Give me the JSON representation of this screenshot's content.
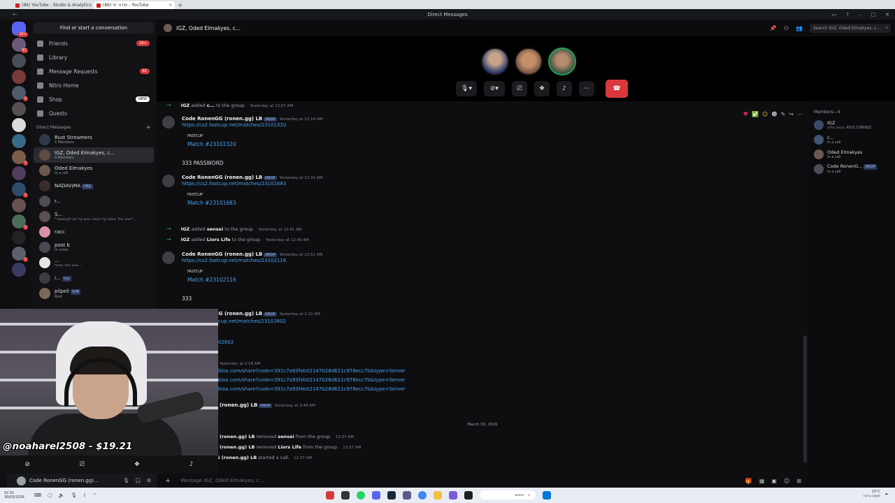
{
  "browser": {
    "tabs": [
      {
        "label": "(86) YouTube - Studio & Analytics",
        "active": false
      },
      {
        "label": "(86) שידור חי - YouTube",
        "active": true
      }
    ]
  },
  "window": {
    "title": "Direct Messages"
  },
  "rail": {
    "badges": [
      "1K+",
      "67",
      "2",
      "1",
      "1",
      "2",
      "1"
    ]
  },
  "sidebar": {
    "find_placeholder": "Find or start a conversation",
    "nav": [
      {
        "label": "Friends",
        "badge": "1K+",
        "icon": "friends-icon"
      },
      {
        "label": "Library",
        "badge": "",
        "icon": "library-icon"
      },
      {
        "label": "Message Requests",
        "badge": "82",
        "icon": "message-requests-icon"
      },
      {
        "label": "Nitro Home",
        "badge": "",
        "icon": "nitro-icon"
      },
      {
        "label": "Shop",
        "badge": "NEW",
        "icon": "shop-icon"
      },
      {
        "label": "Quests",
        "badge": "",
        "icon": "quests-icon"
      }
    ],
    "dm_header": "Direct Messages",
    "dms": [
      {
        "name": "Rust Streamers",
        "sub": "5 Members",
        "selected": false
      },
      {
        "name": "IGZ, Oded Elmakyes, c...",
        "sub": "4 Members",
        "selected": true
      },
      {
        "name": "Oded Elmakyes",
        "sub": "In a call",
        "selected": false
      },
      {
        "name": "NADAVןMA",
        "sub": "",
        "tag": "UNIL",
        "selected": false
      },
      {
        "name": "r...",
        "sub": "",
        "tag": "",
        "selected": false
      },
      {
        "name": "S...",
        "sub": "\"אבא שלך אוסיף על כוספה ואיש על ידם לעבאמסר\"...",
        "selected": false
      },
      {
        "name": "racc",
        "sub": "",
        "selected": false
      },
      {
        "name": "post b",
        "sub": "In voice",
        "selected": false
      },
      {
        "name": "...",
        "sub": "אבא שלך אוסיף...",
        "selected": false
      },
      {
        "name": "i...",
        "sub": "",
        "tag": "שסוי",
        "selected": false
      },
      {
        "name": "pilpeli",
        "sub": "Rust",
        "tag": "SVR",
        "selected": false
      }
    ]
  },
  "user_panel": {
    "name": "Code RonenGG (ronen.gg)..."
  },
  "channel": {
    "title": "IGZ, Oded Elmakyes, c...",
    "search_placeholder": "Search IGZ, Oded Elmakyes, c..."
  },
  "call": {
    "buttons": [
      "mic",
      "camera",
      "screen-share",
      "activities",
      "soundboard",
      "more",
      "hang-up"
    ]
  },
  "messages": {
    "sys_top": {
      "actor": "IGZ",
      "action": "added",
      "target": "c...",
      "tail": "to the group.",
      "time": "Yesterday at 12:07 AM"
    },
    "m1": {
      "user": "Code RonenGG (ronen.gg) LB",
      "tag": "DROP",
      "time": "Yesterday at 12:14 AM",
      "link": "https://cs2.fastcup.net/matches/23101320",
      "embed_provider": "FASTCUP",
      "embed_title": "Match #23101320",
      "followup": "333 PASSWORD"
    },
    "m2": {
      "user": "Code RonenGG (ronen.gg) LB",
      "tag": "DROP",
      "time": "Yesterday at 12:31 AM",
      "link": "https://cs2.fastcup.net/matches/23101683",
      "embed_provider": "FASTCUP",
      "embed_title": "Match #23101683"
    },
    "sys1": {
      "actor": "IGZ",
      "action": "added",
      "target": "sensei",
      "tail": "to the group.",
      "time": "Yesterday at 12:41 AM"
    },
    "sys2": {
      "actor": "IGZ",
      "action": "added",
      "target": "Liors Life",
      "tail": "to the group.",
      "time": "Yesterday at 12:49 AM"
    },
    "m3": {
      "user": "Code RonenGG (ronen.gg) LB",
      "tag": "DROP",
      "time": "Yesterday at 12:51 AM",
      "link": "https://cs2.fastcup.net/matches/23102116",
      "embed_provider": "FASTCUP",
      "embed_title": "Match #23102116",
      "followup": "333"
    },
    "m4": {
      "user": "Code RonenGG (ronen.gg) LB",
      "tag": "DROP",
      "time": "Yesterday at 1:32 AM",
      "link": "cup.net/matches/23102802",
      "embed_title": "02802"
    },
    "m5": {
      "time": "Yesterday at 2:18 AM",
      "links": [
        "blox.com/share?code=391c7a93feb02147b28d621c978ecc7b&type=Server",
        "blox.com/share?code=391c7a93feb02147b28d621c978ecc7b&type=Server",
        "blox.com/share?code=391c7a93feb02147b28d621c978ecc7b&type=Server"
      ]
    },
    "m6": {
      "user": "(ronen.gg) LB",
      "tag": "DROP",
      "time": "Yesterday at 3:44 AM"
    },
    "date_sep": "March 30, 2026",
    "sys3": {
      "actor": "(ronen.gg) LB",
      "action": "removed",
      "target": "sensei",
      "tail": "from the group.",
      "time": "12:37 AM"
    },
    "sys4": {
      "actor": "(ronen.gg) LB",
      "action": "removed",
      "target": "Liors Life",
      "tail": "from the group.",
      "time": "12:37 AM"
    },
    "sys5": {
      "actor": "Code RonenGG (ronen.gg) LB",
      "action": "started a call.",
      "time": "12:37 AM"
    }
  },
  "composer": {
    "placeholder": "Message IGZ, Oded Elmakyes, c..."
  },
  "members": {
    "header": "Members—4",
    "list": [
      {
        "name": "IGZ",
        "status": "בנדים בלייב: KICK.COM/IGZ"
      },
      {
        "name": "c...",
        "status": "In a call"
      },
      {
        "name": "Oded Elmakyes",
        "status": "In a call"
      },
      {
        "name": "Code RonenG...",
        "status": "In a call",
        "tag": "DROP"
      }
    ]
  },
  "overlay": {
    "text": "@noaharel2508 - $19.21"
  },
  "taskbar": {
    "time": "02:31",
    "date": "30/03/2026",
    "search": "חיפוש",
    "weather": "15°C",
    "weather_desc": "מעונן ברובו",
    "right_time": "",
    "right_date": "יום שני 31 מרץ"
  },
  "colors": {
    "accent": "#5865f2",
    "danger": "#da373c",
    "link": "#4aa2f2",
    "online": "#23a559"
  }
}
